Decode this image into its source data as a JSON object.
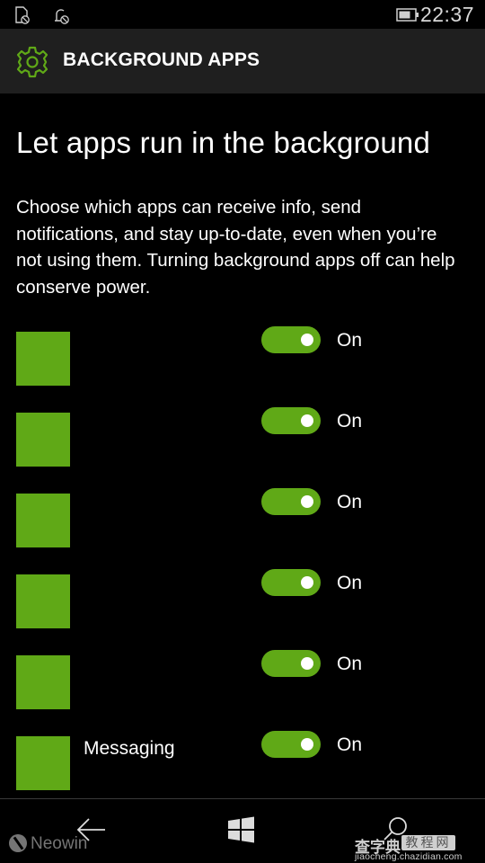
{
  "status_bar": {
    "left_icons": [
      "sim-blocked-icon",
      "notification-blocked-icon"
    ],
    "battery_icon": "battery-icon",
    "time": "22:37"
  },
  "header": {
    "icon": "gear-icon",
    "title": "BACKGROUND APPS"
  },
  "main": {
    "heading": "Let apps run in the background",
    "description": "Choose which apps can receive info, send notifications, and stay up-to-date, even when you’re not using them. Turning background apps off can help conserve power.",
    "apps": [
      {
        "name": "",
        "enabled": true,
        "state_label": "On"
      },
      {
        "name": "",
        "enabled": true,
        "state_label": "On"
      },
      {
        "name": "",
        "enabled": true,
        "state_label": "On"
      },
      {
        "name": "",
        "enabled": true,
        "state_label": "On"
      },
      {
        "name": "",
        "enabled": true,
        "state_label": "On"
      },
      {
        "name": "Messaging",
        "enabled": true,
        "state_label": "On"
      }
    ]
  },
  "nav_bar": {
    "back": "back-arrow-icon",
    "start": "windows-logo-icon",
    "search": "search-icon"
  },
  "watermarks": {
    "neowin": "Neowin",
    "chazidian_main": "查字典",
    "chazidian_box": "教程网",
    "chazidian_url": "jiaocheng.chazidian.com"
  },
  "colors": {
    "accent": "#60A917",
    "background": "#000000",
    "titlebar": "#1F1F1F"
  }
}
